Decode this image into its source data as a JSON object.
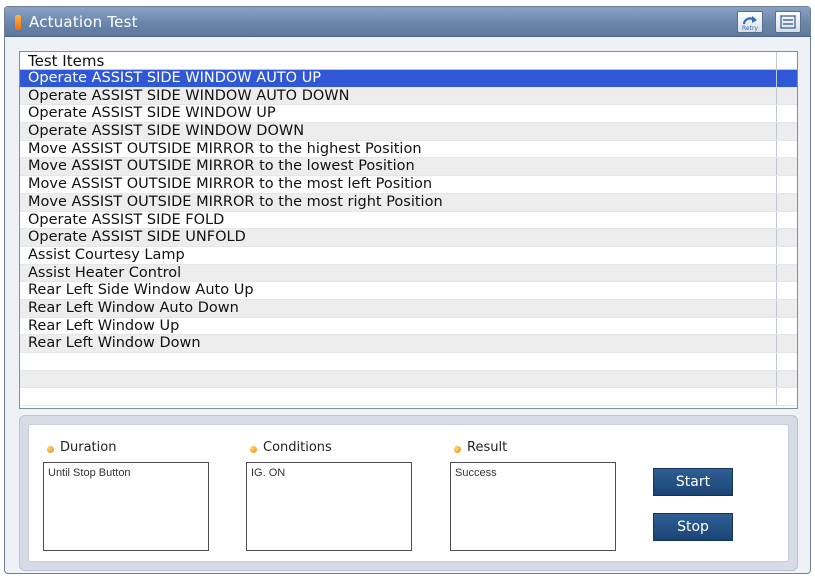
{
  "window": {
    "title": "Actuation Test",
    "retry_label": "Retry",
    "accent_color": "#f28a1a"
  },
  "list": {
    "column_header": "Test Items",
    "selected_index": 0,
    "items": [
      "Operate ASSIST SIDE WINDOW AUTO UP",
      "Operate ASSIST SIDE WINDOW AUTO DOWN",
      "Operate ASSIST SIDE WINDOW UP",
      "Operate ASSIST SIDE WINDOW DOWN",
      "Move ASSIST OUTSIDE  MIRROR to the highest  Position",
      "Move ASSIST OUTSIDE  MIRROR to the lowest  Position",
      "Move ASSIST OUTSIDE  MIRROR to the most left  Position",
      "Move ASSIST OUTSIDE  MIRROR to the most right  Position",
      "Operate ASSIST SIDE  FOLD",
      "Operate ASSIST SIDE  UNFOLD",
      "Assist Courtesy Lamp",
      "Assist Heater Control",
      "Rear Left Side Window Auto Up",
      "Rear Left Window Auto Down",
      "Rear Left Window Up",
      "Rear Left Window Down",
      "",
      "",
      ""
    ]
  },
  "fields": {
    "duration": {
      "label": "Duration",
      "value": "Until Stop Button"
    },
    "conditions": {
      "label": "Conditions",
      "value": "IG. ON"
    },
    "result": {
      "label": "Result",
      "value": "Success"
    }
  },
  "buttons": {
    "start_label": "Start",
    "stop_label": "Stop"
  },
  "icons": {
    "retry": "retry-icon",
    "menu": "menu-icon"
  }
}
